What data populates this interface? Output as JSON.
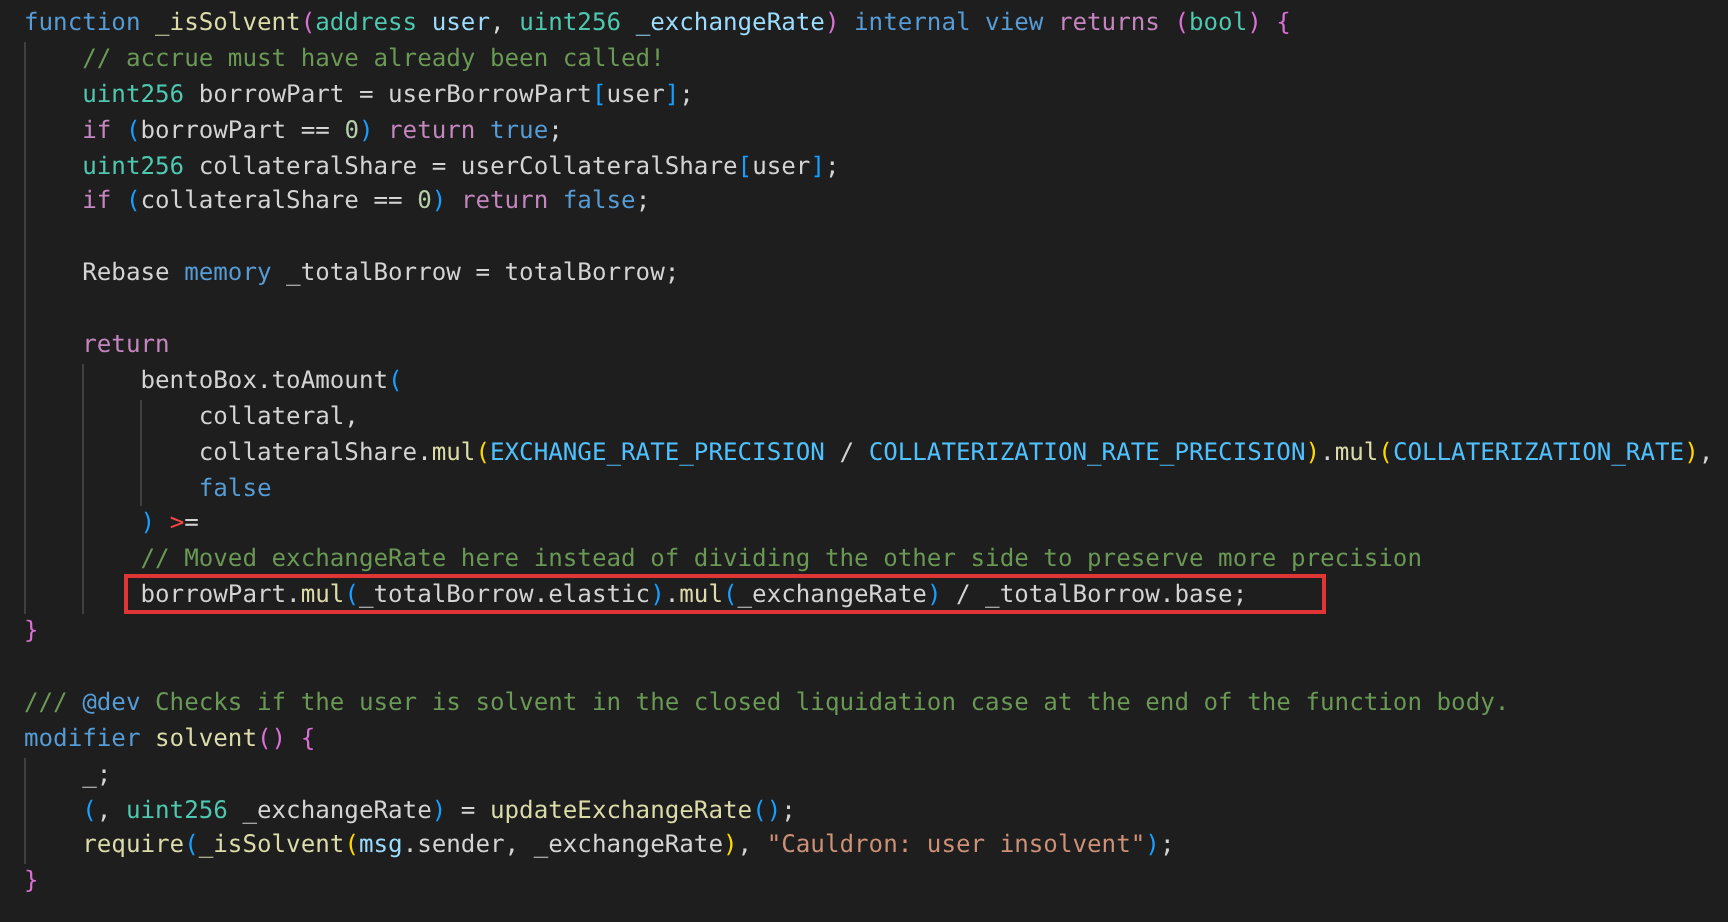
{
  "editor": {
    "lines": [
      {
        "highlighted": false,
        "tokens": [
          {
            "text": "function ",
            "kind": "keyword"
          },
          {
            "text": "_isSolvent",
            "kind": "function"
          },
          {
            "text": "(",
            "kind": "bracket2"
          },
          {
            "text": "address ",
            "kind": "type"
          },
          {
            "text": "user",
            "kind": "variable"
          },
          {
            "text": ", ",
            "kind": "plain"
          },
          {
            "text": "uint256 ",
            "kind": "type"
          },
          {
            "text": "_exchangeRate",
            "kind": "variable"
          },
          {
            "text": ") ",
            "kind": "bracket2"
          },
          {
            "text": "internal view ",
            "kind": "keyword"
          },
          {
            "text": "returns ",
            "kind": "control"
          },
          {
            "text": "(",
            "kind": "bracket2"
          },
          {
            "text": "bool",
            "kind": "type"
          },
          {
            "text": ") {",
            "kind": "bracket2"
          }
        ]
      },
      {
        "highlighted": false,
        "tokens": [
          {
            "text": "    // accrue must have already been called!",
            "kind": "comment"
          }
        ]
      },
      {
        "highlighted": false,
        "tokens": [
          {
            "text": "    uint256",
            "kind": "type"
          },
          {
            "text": " borrowPart = userBorrowPart",
            "kind": "plain"
          },
          {
            "text": "[",
            "kind": "bracket3"
          },
          {
            "text": "user",
            "kind": "plain"
          },
          {
            "text": "]",
            "kind": "bracket3"
          },
          {
            "text": ";",
            "kind": "plain"
          }
        ]
      },
      {
        "highlighted": false,
        "tokens": [
          {
            "text": "    if ",
            "kind": "control"
          },
          {
            "text": "(",
            "kind": "bracket3"
          },
          {
            "text": "borrowPart == ",
            "kind": "plain"
          },
          {
            "text": "0",
            "kind": "number"
          },
          {
            "text": ") ",
            "kind": "bracket3"
          },
          {
            "text": "return ",
            "kind": "control"
          },
          {
            "text": "true",
            "kind": "keyword"
          },
          {
            "text": ";",
            "kind": "plain"
          }
        ]
      },
      {
        "highlighted": false,
        "tokens": [
          {
            "text": "    uint256",
            "kind": "type"
          },
          {
            "text": " collateralShare = userCollateralShare",
            "kind": "plain"
          },
          {
            "text": "[",
            "kind": "bracket3"
          },
          {
            "text": "user",
            "kind": "plain"
          },
          {
            "text": "]",
            "kind": "bracket3"
          },
          {
            "text": ";",
            "kind": "plain"
          }
        ]
      },
      {
        "highlighted": false,
        "tokens": [
          {
            "text": "    if ",
            "kind": "control"
          },
          {
            "text": "(",
            "kind": "bracket3"
          },
          {
            "text": "collateralShare == ",
            "kind": "plain"
          },
          {
            "text": "0",
            "kind": "number"
          },
          {
            "text": ") ",
            "kind": "bracket3"
          },
          {
            "text": "return ",
            "kind": "control"
          },
          {
            "text": "false",
            "kind": "keyword"
          },
          {
            "text": ";",
            "kind": "plain"
          }
        ]
      },
      {
        "highlighted": false
      },
      {
        "highlighted": false,
        "tokens": [
          {
            "text": "    Rebase ",
            "kind": "plain"
          },
          {
            "text": "memory",
            "kind": "keyword"
          },
          {
            "text": " _totalBorrow = totalBorrow;",
            "kind": "plain"
          }
        ]
      },
      {
        "highlighted": false
      },
      {
        "highlighted": false,
        "tokens": [
          {
            "text": "    return",
            "kind": "control"
          }
        ]
      },
      {
        "highlighted": false,
        "tokens": [
          {
            "text": "        bentoBox.toAmount",
            "kind": "plain"
          },
          {
            "text": "(",
            "kind": "bracket3"
          }
        ]
      },
      {
        "highlighted": false,
        "tokens": [
          {
            "text": "            collateral,",
            "kind": "plain"
          }
        ]
      },
      {
        "highlighted": false,
        "tokens": [
          {
            "text": "            collateralShare.",
            "kind": "plain"
          },
          {
            "text": "mul",
            "kind": "function"
          },
          {
            "text": "(",
            "kind": "bracket1"
          },
          {
            "text": "EXCHANGE_RATE_PRECISION",
            "kind": "constant"
          },
          {
            "text": " / ",
            "kind": "plain"
          },
          {
            "text": "COLLATERIZATION_RATE_PRECISION",
            "kind": "constant"
          },
          {
            "text": ")",
            "kind": "bracket1"
          },
          {
            "text": ".",
            "kind": "plain"
          },
          {
            "text": "mul",
            "kind": "function"
          },
          {
            "text": "(",
            "kind": "bracket1"
          },
          {
            "text": "COLLATERIZATION_RATE",
            "kind": "constant"
          },
          {
            "text": ")",
            "kind": "bracket1"
          },
          {
            "text": ",",
            "kind": "plain"
          }
        ]
      },
      {
        "highlighted": false,
        "tokens": [
          {
            "text": "            false",
            "kind": "keyword"
          }
        ]
      },
      {
        "highlighted": false,
        "tokens": [
          {
            "text": "        ) ",
            "kind": "bracket3"
          },
          {
            "text": ">",
            "kind": "invalid"
          },
          {
            "text": "=",
            "kind": "plain"
          }
        ]
      },
      {
        "highlighted": false,
        "tokens": [
          {
            "text": "        // Moved exchangeRate here instead of dividing the other side to preserve more precision",
            "kind": "comment"
          }
        ]
      },
      {
        "highlighted": true,
        "tokens": [
          {
            "text": "        borrowPart.",
            "kind": "plain"
          },
          {
            "text": "mul",
            "kind": "function"
          },
          {
            "text": "(",
            "kind": "bracket3"
          },
          {
            "text": "_totalBorrow.elastic",
            "kind": "plain"
          },
          {
            "text": ")",
            "kind": "bracket3"
          },
          {
            "text": ".",
            "kind": "plain"
          },
          {
            "text": "mul",
            "kind": "function"
          },
          {
            "text": "(",
            "kind": "bracket3"
          },
          {
            "text": "_exchangeRate",
            "kind": "plain"
          },
          {
            "text": ")",
            "kind": "bracket3"
          },
          {
            "text": " / _totalBorrow.base;",
            "kind": "plain"
          }
        ]
      },
      {
        "highlighted": false,
        "tokens": [
          {
            "text": "}",
            "kind": "bracket2"
          }
        ]
      },
      {
        "highlighted": false
      },
      {
        "highlighted": false,
        "tokens": [
          {
            "text": "/// ",
            "kind": "comment"
          },
          {
            "text": "@dev",
            "kind": "keyword"
          },
          {
            "text": " Checks if the user is solvent in the closed liquidation case at the end of the function body.",
            "kind": "comment"
          }
        ]
      },
      {
        "highlighted": false,
        "tokens": [
          {
            "text": "modifier ",
            "kind": "keyword"
          },
          {
            "text": "solvent",
            "kind": "function"
          },
          {
            "text": "() {",
            "kind": "bracket2"
          }
        ]
      },
      {
        "highlighted": false,
        "tokens": [
          {
            "text": "    _;",
            "kind": "plain"
          }
        ]
      },
      {
        "highlighted": false,
        "tokens": [
          {
            "text": "    (",
            "kind": "bracket3"
          },
          {
            "text": ", ",
            "kind": "plain"
          },
          {
            "text": "uint256",
            "kind": "type"
          },
          {
            "text": " _exchangeRate",
            "kind": "plain"
          },
          {
            "text": ")",
            "kind": "bracket3"
          },
          {
            "text": " = ",
            "kind": "plain"
          },
          {
            "text": "updateExchangeRate",
            "kind": "function"
          },
          {
            "text": "()",
            "kind": "bracket3"
          },
          {
            "text": ";",
            "kind": "plain"
          }
        ]
      },
      {
        "highlighted": false,
        "tokens": [
          {
            "text": "    require",
            "kind": "function"
          },
          {
            "text": "(",
            "kind": "bracket3"
          },
          {
            "text": "_isSolvent",
            "kind": "function"
          },
          {
            "text": "(",
            "kind": "bracket1"
          },
          {
            "text": "msg",
            "kind": "variable"
          },
          {
            "text": ".sender, _exchangeRate",
            "kind": "plain"
          },
          {
            "text": ")",
            "kind": "bracket1"
          },
          {
            "text": ", ",
            "kind": "plain"
          },
          {
            "text": "\"Cauldron: user insolvent\"",
            "kind": "string"
          },
          {
            "text": ")",
            "kind": "bracket3"
          },
          {
            "text": ";",
            "kind": "plain"
          }
        ]
      },
      {
        "highlighted": false,
        "tokens": [
          {
            "text": "}",
            "kind": "bracket2"
          }
        ]
      }
    ]
  }
}
